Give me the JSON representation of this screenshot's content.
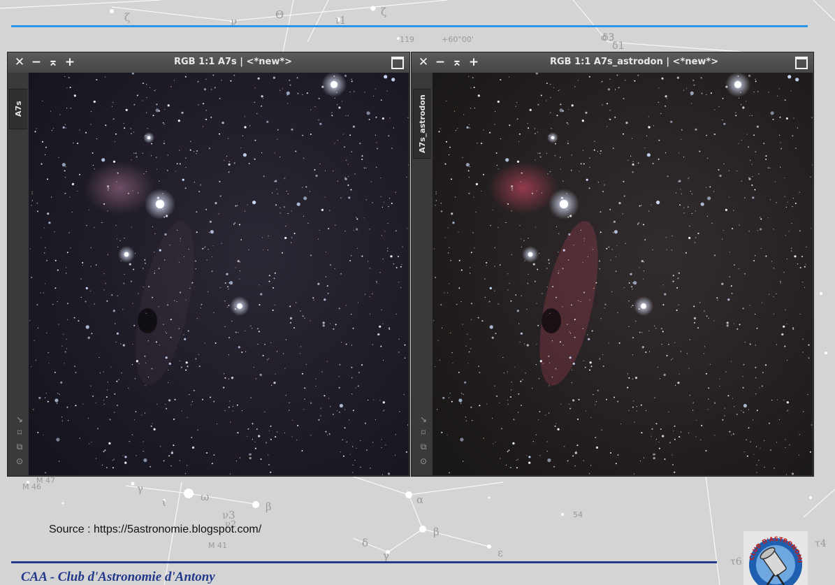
{
  "background": {
    "star_labels": [
      "ζ",
      "ν",
      "Θ",
      "ι1",
      "ζ",
      "119",
      "+60°00'",
      "σ",
      "δ3",
      "δ1",
      "M 47",
      "M 46",
      "γ",
      "ι",
      "ω",
      "ν3",
      "ν2",
      "β",
      "α",
      "54",
      "M 41",
      "δ",
      "γ",
      "β",
      "ε",
      "τ4",
      "τ6"
    ]
  },
  "windows": [
    {
      "title": "RGB 1:1 A7s | <*new*>",
      "side_tab": "A7s",
      "colors": {
        "sky": "#2b2734",
        "sky_dark": "#16141d",
        "nebula": "#8b5f7a"
      }
    },
    {
      "title": "RGB 1:1 A7s_astrodon | <*new*>",
      "side_tab": "A7s_astrodon",
      "colors": {
        "sky": "#332c2f",
        "sky_dark": "#1a1717",
        "nebula": "#b8445a"
      }
    }
  ],
  "titlebar_icons": {
    "close": "✕",
    "minimize": "−",
    "shade": "⌅",
    "add": "+"
  },
  "tool_icons": [
    "↘",
    "⌑",
    "⧉",
    "⊙"
  ],
  "source": "Source : https://5astronomie.blogspot.com/",
  "footer": "CAA - Club d'Astronomie d'Antony",
  "logo_text": "CLUB D'ASTRONOMIE",
  "accent_colors": {
    "top_rule": "#2a97e6",
    "bottom_rule": "#283a8c",
    "footer_text": "#22388a"
  }
}
